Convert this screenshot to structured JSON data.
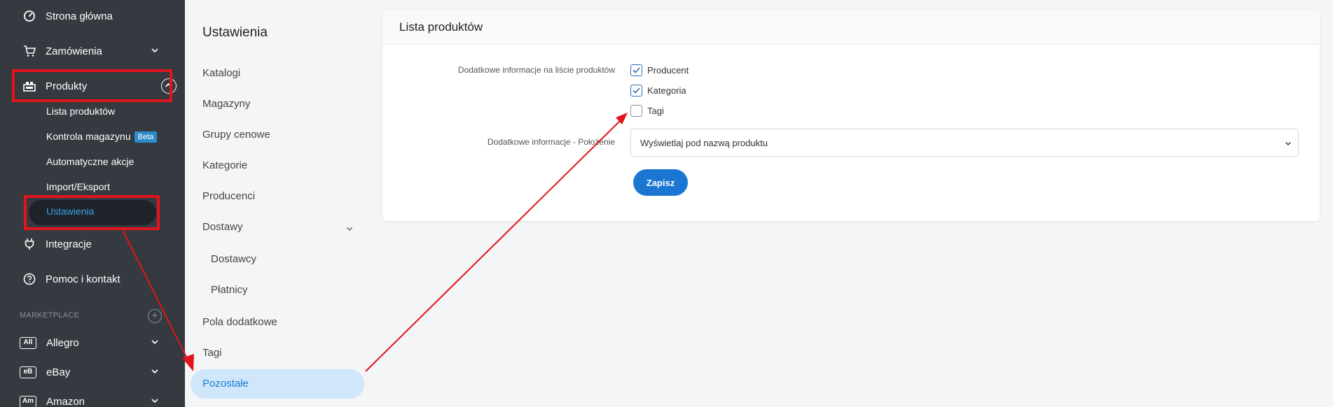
{
  "sidebar": {
    "items": [
      {
        "label": "Strona główna",
        "icon": "dashboard-icon"
      },
      {
        "label": "Zamówienia",
        "icon": "cart-icon"
      },
      {
        "label": "Produkty",
        "icon": "products-icon"
      },
      {
        "label": "Integracje",
        "icon": "plug-icon"
      },
      {
        "label": "Pomoc i kontakt",
        "icon": "help-icon"
      }
    ],
    "products_sub": [
      {
        "label": "Lista produktów"
      },
      {
        "label": "Kontrola magazynu",
        "badge": "Beta"
      },
      {
        "label": "Automatyczne akcje"
      },
      {
        "label": "Import/Eksport"
      },
      {
        "label": "Ustawienia"
      }
    ],
    "marketplace_label": "MARKETPLACE",
    "marketplaces": [
      {
        "label": "Allegro",
        "badge": "All"
      },
      {
        "label": "eBay",
        "badge": "eB"
      },
      {
        "label": "Amazon",
        "badge": "Am"
      }
    ]
  },
  "settings_nav": {
    "title": "Ustawienia",
    "items": [
      {
        "label": "Katalogi"
      },
      {
        "label": "Magazyny"
      },
      {
        "label": "Grupy cenowe"
      },
      {
        "label": "Kategorie"
      },
      {
        "label": "Producenci"
      },
      {
        "label": "Dostawy"
      },
      {
        "label": "Dostawcy"
      },
      {
        "label": "Płatnicy"
      },
      {
        "label": "Pola dodatkowe"
      },
      {
        "label": "Tagi"
      },
      {
        "label": "Pozostałe"
      }
    ]
  },
  "card": {
    "title": "Lista produktów",
    "field1_label": "Dodatkowe informacje na liście produktów",
    "checkboxes": [
      {
        "label": "Producent",
        "checked": true
      },
      {
        "label": "Kategoria",
        "checked": true
      },
      {
        "label": "Tagi",
        "checked": false
      }
    ],
    "field2_label": "Dodatkowe informacje - Położenie",
    "select_value": "Wyświetlaj pod nazwą produktu",
    "save_label": "Zapisz"
  },
  "colors": {
    "sidebar_bg": "#343a40",
    "accent": "#1b76d2",
    "annotation": "#e3141b"
  }
}
